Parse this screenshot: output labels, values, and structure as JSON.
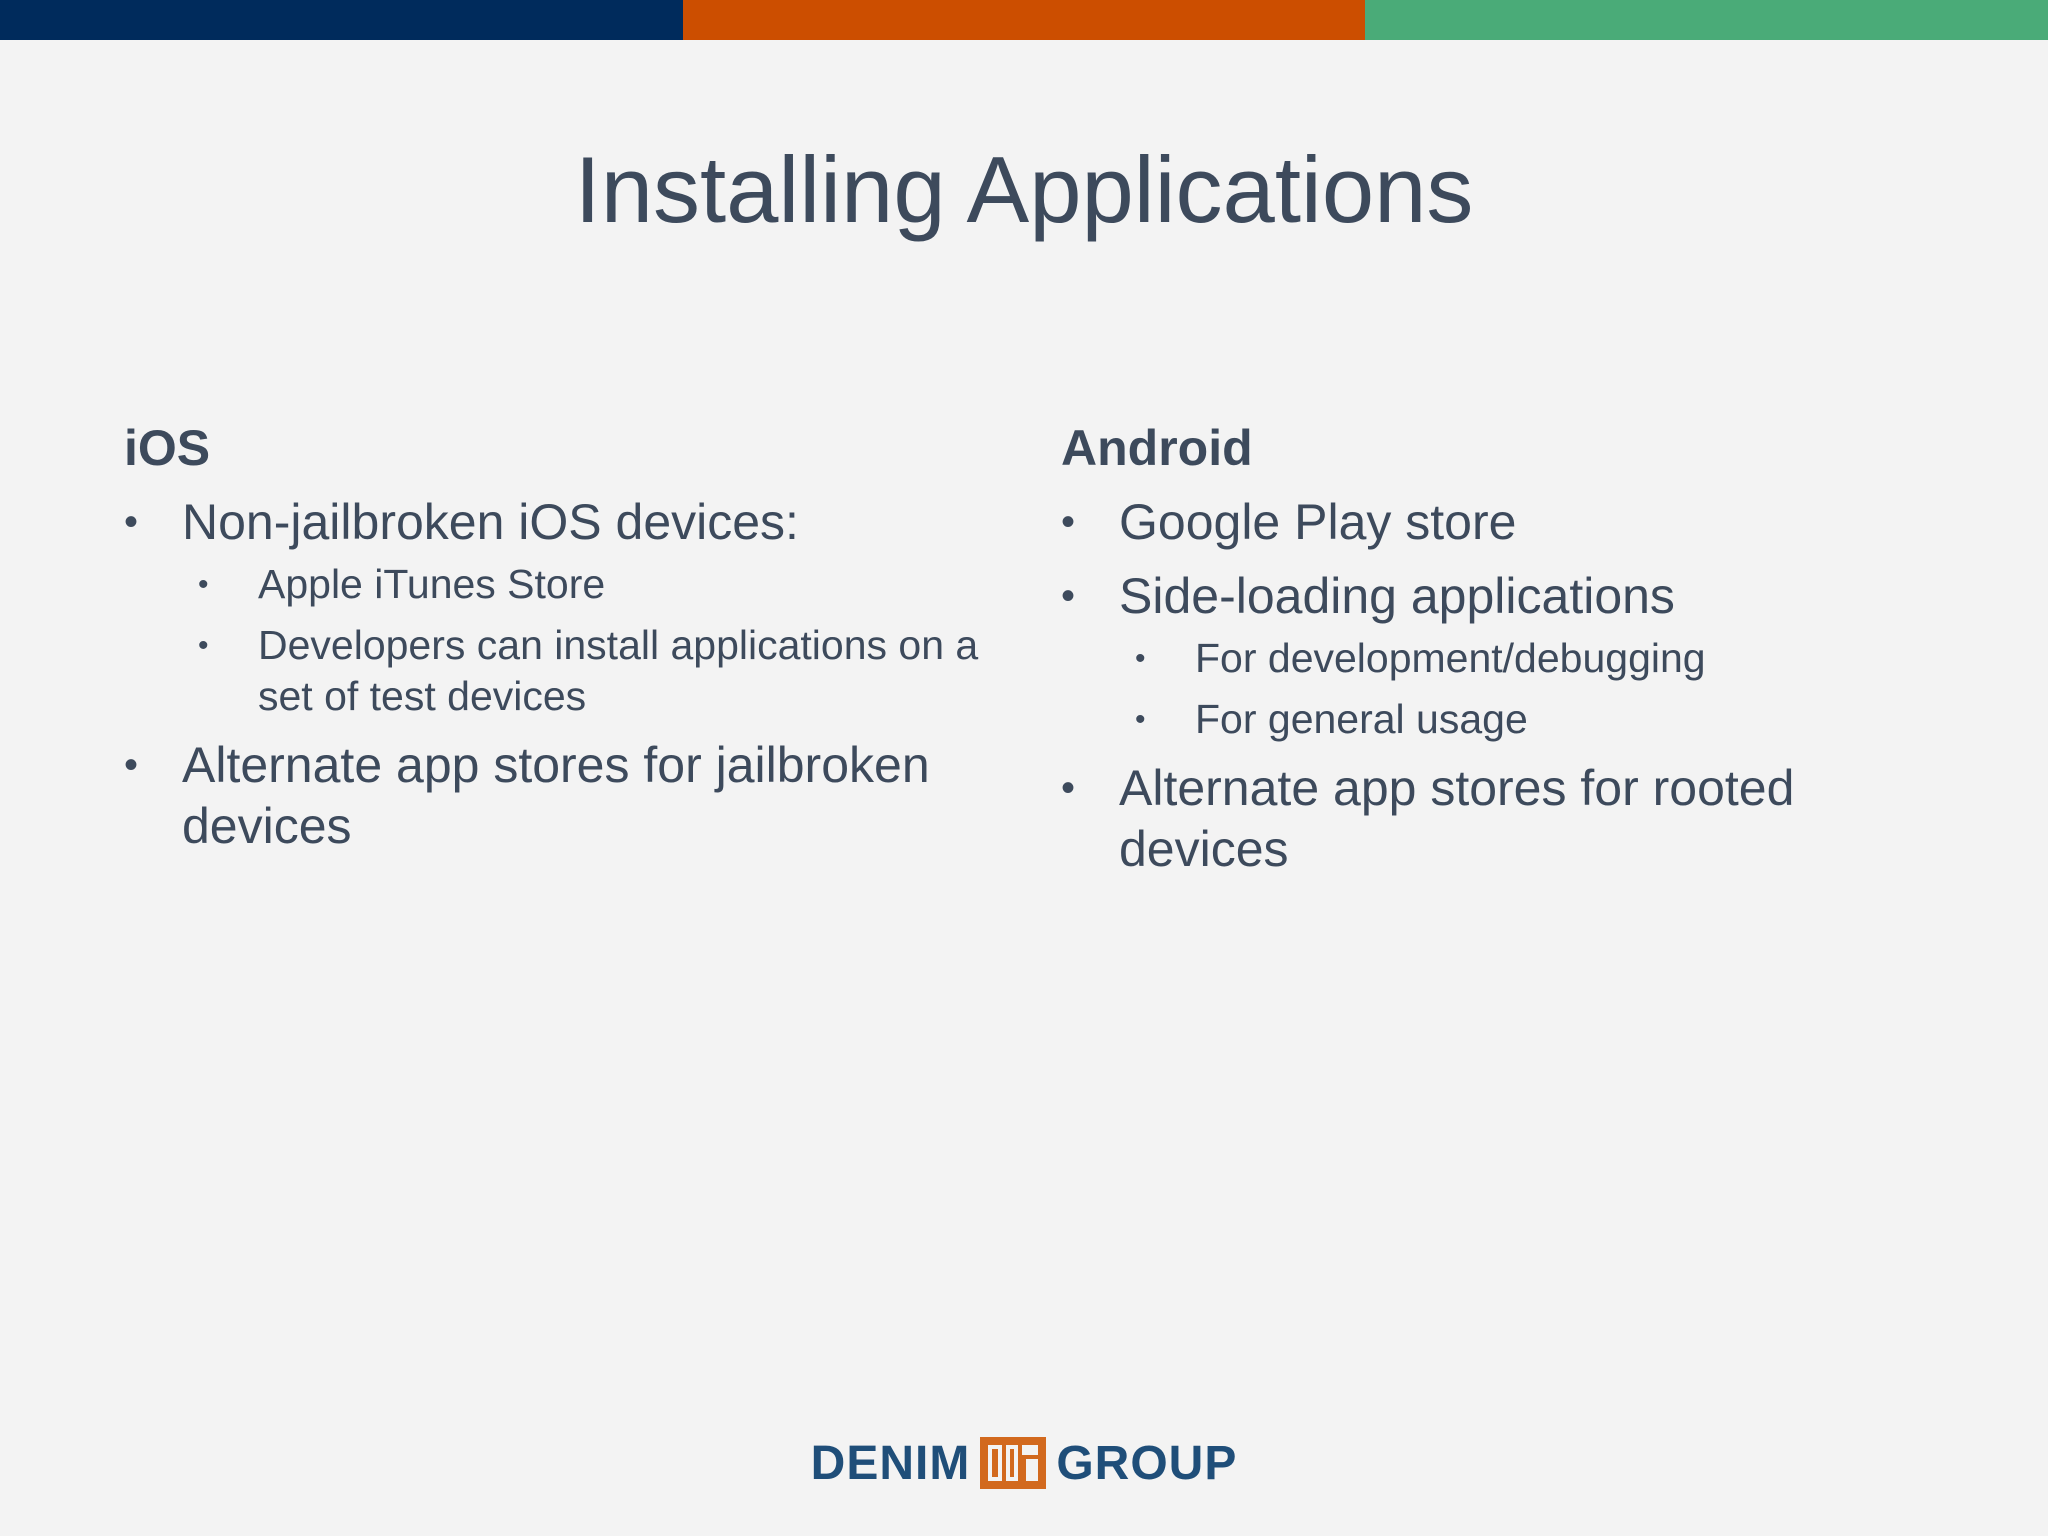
{
  "colors": {
    "topbar": [
      "#002b5c",
      "#cc4e00",
      "#4aab78"
    ],
    "text": "#3d4a5c",
    "logo_text": "#1f4e79",
    "logo_mark": "#d2691e",
    "background": "#f3f3f3"
  },
  "slide": {
    "title": "Installing Applications"
  },
  "ios": {
    "heading": "iOS",
    "items": [
      {
        "text": "Non-jailbroken iOS devices:",
        "sub": [
          "Apple iTunes Store",
          "Developers can install applications on a set of test devices"
        ]
      },
      {
        "text": "Alternate app stores for jailbroken devices"
      }
    ]
  },
  "android": {
    "heading": "Android",
    "items": [
      {
        "text": "Google Play store"
      },
      {
        "text": "Side-loading applications",
        "sub": [
          "For development/debugging",
          "For general usage"
        ]
      },
      {
        "text": "Alternate app stores for rooted devices"
      }
    ]
  },
  "logo": {
    "left_word": "DENIM",
    "right_word": "GROUP",
    "icon": "denim-group-logo-icon"
  }
}
